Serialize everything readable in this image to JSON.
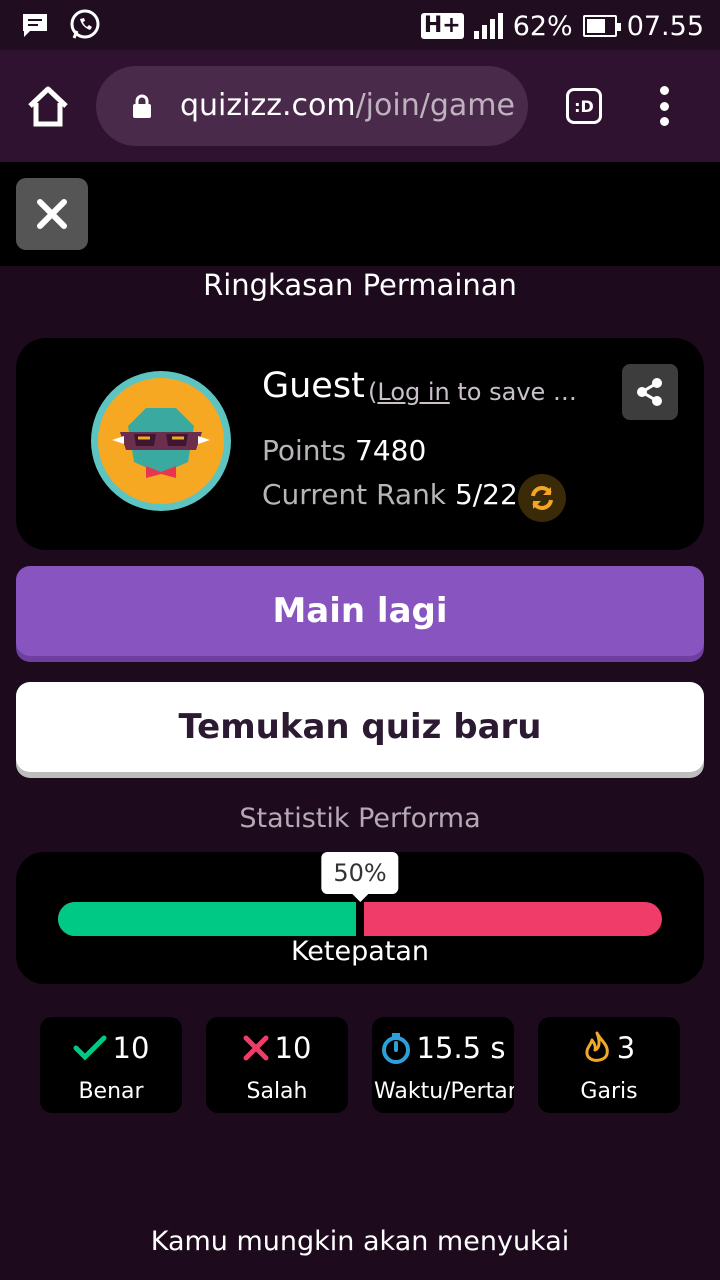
{
  "status_bar": {
    "network": "H+",
    "battery": "62%",
    "time": "07.55"
  },
  "browser": {
    "url_domain": "quizizz.com",
    "url_path": "/join/game",
    "tab_label": ":D"
  },
  "summary": {
    "title": "Ringkasan Permainan",
    "player_name": "Guest",
    "login_prefix": "(",
    "login_link": "Log in",
    "login_suffix": " to save r...",
    "points_label": "Points",
    "points_value": "7480",
    "rank_label": "Current Rank",
    "rank_value": "5/22"
  },
  "actions": {
    "play_again": "Main lagi",
    "new_quiz": "Temukan quiz baru"
  },
  "stats": {
    "title": "Statistik Performa",
    "accuracy_percent_label": "50%",
    "accuracy_fraction": 0.5,
    "accuracy_label": "Ketepatan",
    "tiles": [
      {
        "value": "10",
        "label": "Benar",
        "icon": "check-icon",
        "color": "#00c985"
      },
      {
        "value": "10",
        "label": "Salah",
        "icon": "cross-icon",
        "color": "#ef3c69"
      },
      {
        "value": "15.5 s",
        "label": "Waktu/Pertanyaan",
        "icon": "stopwatch-icon",
        "color": "#2d9fd9"
      },
      {
        "value": "3",
        "label": "Garis",
        "icon": "flame-icon",
        "color": "#efa929"
      }
    ]
  },
  "footer": {
    "recommend": "Kamu mungkin akan menyukai"
  },
  "colors": {
    "accent_purple": "#8854c0",
    "correct_green": "#00c985",
    "incorrect_red": "#ef3c69"
  }
}
